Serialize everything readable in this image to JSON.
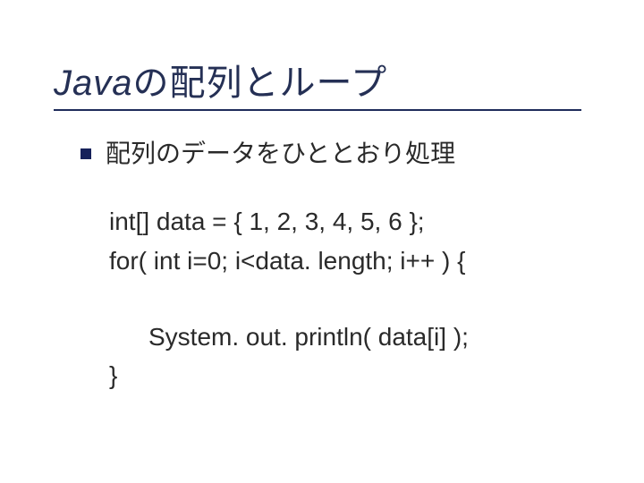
{
  "title": {
    "italic": "Java",
    "rest": "の配列とループ"
  },
  "bullet": {
    "text": "配列のデータをひととおり処理"
  },
  "code": {
    "l1": "int[] data = { 1, 2, 3, 4, 5, 6 };",
    "l2": "for( int i=0; i<data. length; i++ ) {",
    "l3": "System. out. println( data[i] );",
    "l4": "}"
  }
}
